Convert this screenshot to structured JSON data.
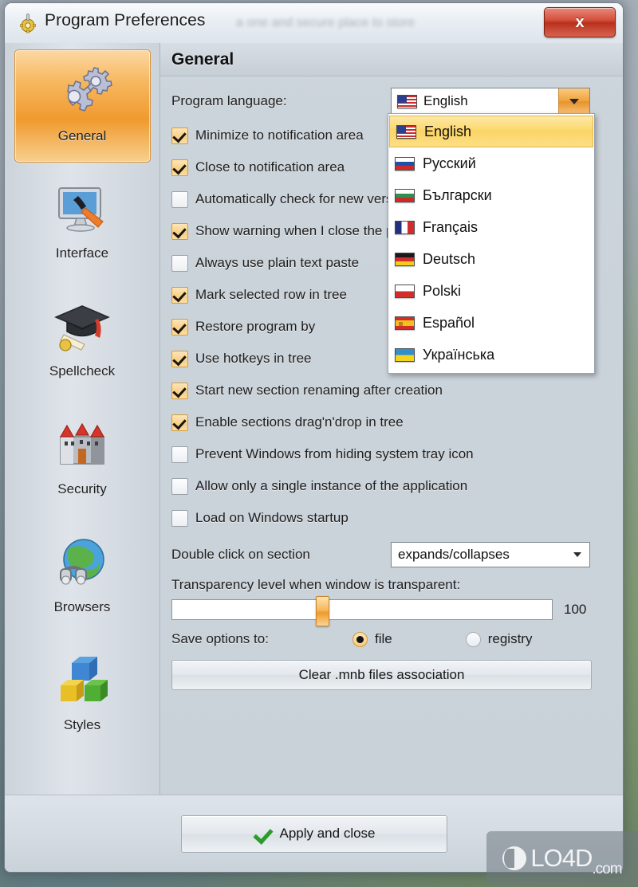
{
  "window": {
    "title": "Program Preferences",
    "title_ghost": "a one and secure place to store",
    "icon": "gear-screwdriver-icon",
    "close_label": "x"
  },
  "sidebar": {
    "items": [
      {
        "label": "General",
        "icon": "gears-icon",
        "selected": true
      },
      {
        "label": "Interface",
        "icon": "monitor-brush-icon",
        "selected": false
      },
      {
        "label": "Spellcheck",
        "icon": "graduation-cap-icon",
        "selected": false
      },
      {
        "label": "Security",
        "icon": "castle-icon",
        "selected": false
      },
      {
        "label": "Browsers",
        "icon": "globe-binoculars-icon",
        "selected": false
      },
      {
        "label": "Styles",
        "icon": "blocks-icon",
        "selected": false
      }
    ]
  },
  "page": {
    "title": "General",
    "language": {
      "label": "Program language:",
      "selected": "English",
      "selected_flag": "f-us",
      "dropdown_open": true,
      "options": [
        {
          "label": "English",
          "flag": "f-us",
          "highlighted": true
        },
        {
          "label": "Русский",
          "flag": "f-ru",
          "highlighted": false
        },
        {
          "label": "Български",
          "flag": "f-bg",
          "highlighted": false
        },
        {
          "label": "Français",
          "flag": "f-fr",
          "highlighted": false
        },
        {
          "label": "Deutsch",
          "flag": "f-de",
          "highlighted": false
        },
        {
          "label": "Polski",
          "flag": "f-pl",
          "highlighted": false
        },
        {
          "label": "Español",
          "flag": "f-es",
          "highlighted": false
        },
        {
          "label": "Українська",
          "flag": "f-ua",
          "highlighted": false
        }
      ]
    },
    "checkboxes": [
      {
        "label": "Minimize to notification area",
        "checked": true
      },
      {
        "label": "Close to notification area",
        "checked": true
      },
      {
        "label": "Automatically check for new version",
        "checked": false
      },
      {
        "label": "Show warning when I close the program",
        "checked": true
      },
      {
        "label": "Always use plain text paste",
        "checked": false
      },
      {
        "label": "Mark selected row in tree",
        "checked": true
      },
      {
        "label": "Restore program by",
        "checked": true
      },
      {
        "label": "Use hotkeys in tree",
        "checked": true
      },
      {
        "label": "Start new section renaming after creation",
        "checked": true
      },
      {
        "label": "Enable sections drag'n'drop in tree",
        "checked": true
      },
      {
        "label": "Prevent Windows from hiding system tray icon",
        "checked": false
      },
      {
        "label": "Allow only a single instance of the application",
        "checked": false
      },
      {
        "label": "Load on Windows startup",
        "checked": false
      }
    ],
    "double_click": {
      "label": "Double click on section",
      "selected": "expands/collapses"
    },
    "transparency": {
      "label": "Transparency level when window is transparent:",
      "value": "100",
      "percent": 39
    },
    "save_options": {
      "label": "Save options to:",
      "choices": [
        {
          "label": "file",
          "selected": true
        },
        {
          "label": "registry",
          "selected": false
        }
      ]
    },
    "clear_button": "Clear .mnb files association"
  },
  "footer": {
    "apply_label": "Apply and close",
    "apply_icon": "green-check-icon"
  },
  "watermark": {
    "name": "LO4D",
    "domain": ".com"
  },
  "colors": {
    "accent_orange": "#f0a43f",
    "highlight_yellow": "#fbd566",
    "close_red": "#d4503c",
    "panel_bg": "#c9d1d9"
  }
}
